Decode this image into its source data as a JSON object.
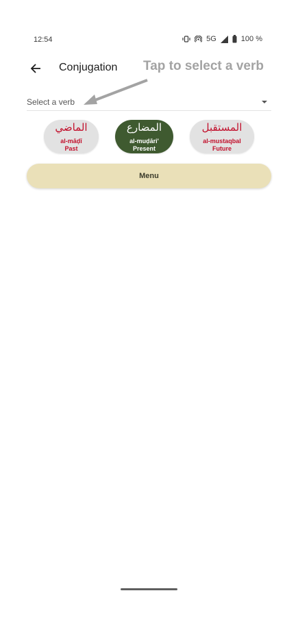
{
  "status_bar": {
    "time": "12:54",
    "network": "5G",
    "battery": "100 %"
  },
  "app_bar": {
    "title": "Conjugation",
    "hint": "Tap to select a verb"
  },
  "verb_select": {
    "placeholder": "Select a verb"
  },
  "tenses": [
    {
      "arabic": "الماضي",
      "translit": "al-māḍī",
      "english": "Past",
      "active": false
    },
    {
      "arabic": "المضارع",
      "translit": "al-muḍāri'",
      "english": "Present",
      "active": true
    },
    {
      "arabic": "المستقبل",
      "translit": "al-mustaqbal",
      "english": "Future",
      "active": false
    }
  ],
  "menu": {
    "label": "Menu"
  },
  "colors": {
    "accent_green": "#3f5a30",
    "arabic_red": "#c2102c",
    "chip_gray": "#e2e2e2",
    "menu_bg": "#eae0b8",
    "hint_gray": "#a3a3a3"
  }
}
